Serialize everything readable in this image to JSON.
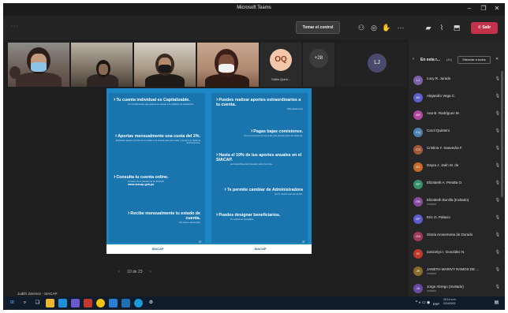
{
  "window": {
    "title": "Microsoft Teams"
  },
  "toolbar": {
    "take_control_label": "Tomar el control",
    "leave_label": "Salir",
    "more_label": "···"
  },
  "video_strip": {
    "oq_initials": "OQ",
    "oq_name": "Odilis Quint...",
    "overflow_count": "+28",
    "lj_initials": "LJ"
  },
  "slide": {
    "left_items": [
      {
        "heading": "Tu cuenta individual es Capitalizable.",
        "sub": "Los rendimientos que genera se suman a tu capital y se reinvierten."
      },
      {
        "heading": "Aportas mensualmente una cuota del 2%.",
        "sub": "El Estado aporta el 0,3% de tu sueldo a tu cuenta para acumular y sumar a tu Sistema de Pensiones."
      },
      {
        "heading": "Consulta tu cuenta online.",
        "sub": "A través de la plataforma de SIACAP",
        "link": "www.siacap.gob.pa"
      },
      {
        "heading": "Recibe mensualmente tu estado de cuenta.",
        "sub": "Vía correo electrónico"
      }
    ],
    "right_items": [
      {
        "heading": "Puedes realizar aportes extraordinarios a tu cuenta.",
        "sub": "Voluntariamente"
      },
      {
        "heading": "Pagas bajas comisiones.",
        "sub": "Por los servicios de los entes que forman parte del Sistema."
      },
      {
        "heading": "Hasta el 10% de tus aportes anuales en el SIACAP.",
        "sub": "ser deducibles del Impuesto sobre la renta."
      },
      {
        "heading": "Te permite cambiar de Administradora",
        "sub": "por lo menos una vez al año."
      },
      {
        "heading": "Puedes designar beneficiarios.",
        "sub": "Tu cuenta es heredable"
      }
    ],
    "footer_logo": "SIACAP",
    "page_number": "37"
  },
  "pager": {
    "prev": "‹",
    "label": "10 de 23",
    "next": "›"
  },
  "presenter": {
    "name": "Judith Jiménez - SIACAP"
  },
  "people": {
    "title": "En esta r...",
    "count": "(41)",
    "mute_all_label": "Silenciar a todos",
    "list": [
      {
        "initials": "LJ",
        "name": "Lucy R. Jurado",
        "sub": "",
        "color": "#7b61a8"
      },
      {
        "initials": "AV",
        "name": "Alejandro Vega C.",
        "sub": "",
        "color": "#5b5fc7"
      },
      {
        "initials": "AR",
        "name": "Ana B. Rodríguez M.",
        "sub": "",
        "color": "#b04aa0"
      },
      {
        "initials": "CQ",
        "name": "Carol Quintero",
        "sub": "",
        "color": "#4a7fb0"
      },
      {
        "initials": "CS",
        "name": "Cristina Y. Saavedra F.",
        "sub": "",
        "color": "#a05a3a"
      },
      {
        "initials": "DJ",
        "name": "Dayra J. Jaén M. de",
        "sub": "",
        "color": "#c46a2a"
      },
      {
        "initials": "EP",
        "name": "Elizabeth A. Peralta O.",
        "sub": "",
        "color": "#3a8f6a"
      },
      {
        "initials": "EB",
        "name": "Elizabeth Bonilla (Invitado)",
        "sub": "Invitado",
        "color": "#8a4aa0"
      },
      {
        "initials": "EP",
        "name": "Eric O. Palacio",
        "sub": "",
        "color": "#5b5fc7"
      },
      {
        "initials": "GA",
        "name": "Gloria Arosemena de Dorado",
        "sub": "",
        "color": "#a03a5a"
      },
      {
        "initials": "IG",
        "name": "Iamicelys I. González N.",
        "sub": "",
        "color": "#c0392b"
      },
      {
        "initials": "JR",
        "name": "JANETH MARIVY RAMOS DE ...",
        "sub": "Invitado",
        "color": "#8a6a2a"
      },
      {
        "initials": "JA",
        "name": "Jorge Abrego (Invitado)",
        "sub": "Invitado",
        "color": "#6a4aa0"
      }
    ]
  },
  "taskbar": {
    "time": "10:14 a.m.",
    "date": "2/24/2021",
    "lang": "ESP"
  }
}
